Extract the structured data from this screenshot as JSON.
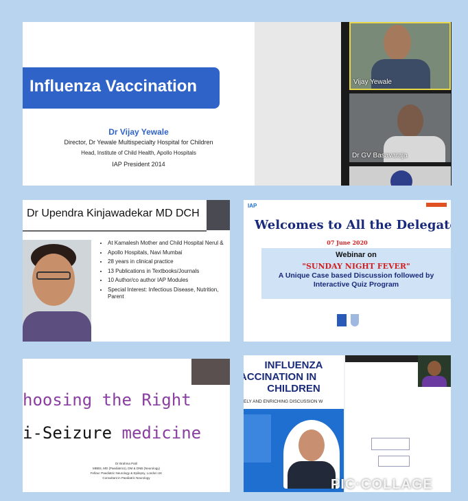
{
  "tile1": {
    "title": "Influenza Vaccination",
    "speaker_name": "Dr Vijay Yewale",
    "line1": "Director, Dr Yewale Multispecialty Hospital for Children",
    "line2": "Head, Institute of Child Health, Apollo Hospitals",
    "line3": "IAP President 2014",
    "participants": [
      {
        "name": "Vijay Yewale"
      },
      {
        "name": "Dr GV Basavaraja"
      }
    ]
  },
  "tile2": {
    "title": "Dr Upendra Kinjawadekar MD DCH",
    "bullets": [
      "At Kamalesh Mother and Child Hospital Nerul &",
      "Apollo Hospitals, Navi Mumbai",
      "28 years in clinical practice",
      "13 Publications in Textbooks/Journals",
      "10 Author/co author IAP Modules",
      "Special Interest: Infectious Disease, Nutrition, Parent"
    ]
  },
  "tile3": {
    "logo": "IAP",
    "header": "Welcomes to All the Delegate",
    "date": "07 June 2020",
    "webinar_on": "Webinar on",
    "event": "\"SUNDAY NIGHT FEVER\"",
    "subtitle": "A Unique Case based Discussion followed by Interactive Quiz Program"
  },
  "tile4": {
    "line1": "hoosing the Right",
    "line2a": "i-Seizure",
    "line2b": "medicine",
    "credit1": "Dr Brahma Patil",
    "credit2": "MBBS, MD (Paediatrics), DM & DNB (Neurology)",
    "credit3": "Fellow: Paediatric Neurology & Epilepsy, London UK",
    "credit4": "Consultant in Paediatric Neurology"
  },
  "tile5": {
    "title1": "INFLUENZA",
    "title2": "ACCINATION IN",
    "title3": "CHILDREN",
    "tagline": "ELY AND ENRICHING DISCUSSION W"
  },
  "watermark": "PIC·COLLAGE",
  "colors": {
    "background": "#b8d4ee",
    "title_blue": "#2f63c8",
    "banner_blue": "#1f6fd1",
    "red_text": "#d02020",
    "purple_text": "#8a3fa0",
    "navy_text": "#1a2a7a"
  }
}
